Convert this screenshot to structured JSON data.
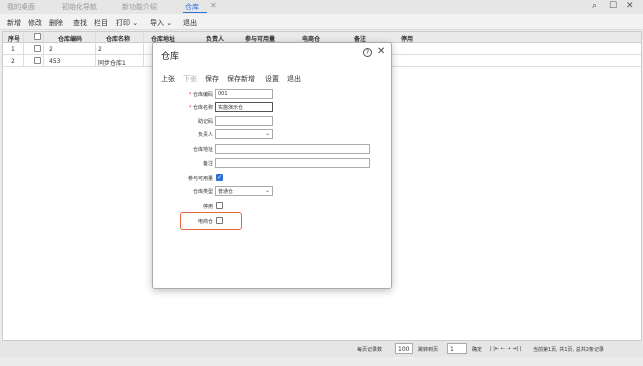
{
  "tabs": [
    {
      "label": "我的桌面"
    },
    {
      "label": "初始化导航"
    },
    {
      "label": "新功能介绍"
    },
    {
      "label": "仓库"
    }
  ],
  "window_controls": [
    "search-icon",
    "restore-icon",
    "close-icon"
  ],
  "toolbar": {
    "items": [
      "新增",
      "修改",
      "删除",
      "查找",
      "栏目",
      "打印",
      "导入",
      "退出"
    ]
  },
  "grid": {
    "headers": [
      "序号",
      "仓库编码",
      "仓库名称",
      "仓库地址",
      "负责人",
      "参与可用量",
      "电商仓",
      "备注",
      "停用"
    ],
    "rows": [
      {
        "index": "1",
        "code": "2",
        "name": "2"
      },
      {
        "index": "2",
        "code": "453",
        "name": "同步仓库1"
      }
    ]
  },
  "footer": {
    "per_page_label": "每页记录数",
    "per_page_value": "100",
    "jump_label": "跳转到页",
    "jump_value": "1",
    "confirm": "确定",
    "page_info": "当前第1页, 共1页, 总共2条记录"
  },
  "dialog": {
    "title": "仓库",
    "buttons": [
      "上张",
      "下张",
      "保存",
      "保存新增",
      "设置",
      "退出"
    ],
    "fields": {
      "code_label": "仓库编码",
      "code_value": "001",
      "name_label": "仓库名称",
      "name_value": "实施演示仓",
      "mnemonic_label": "助记码",
      "mnemonic_value": "",
      "manager_label": "负责人",
      "manager_value": "",
      "address_label": "仓库地址",
      "address_value": "",
      "remark_label": "备注",
      "remark_value": "",
      "available_label": "参与可用量",
      "available_checked": true,
      "type_label": "仓库类型",
      "type_value": "普通仓",
      "disabled_label": "停用",
      "disabled_checked": false,
      "ecommerce_label": "电商仓",
      "ecommerce_checked": false
    }
  },
  "colors": {
    "accent": "#2f6fd6",
    "highlight": "#e8663d"
  }
}
